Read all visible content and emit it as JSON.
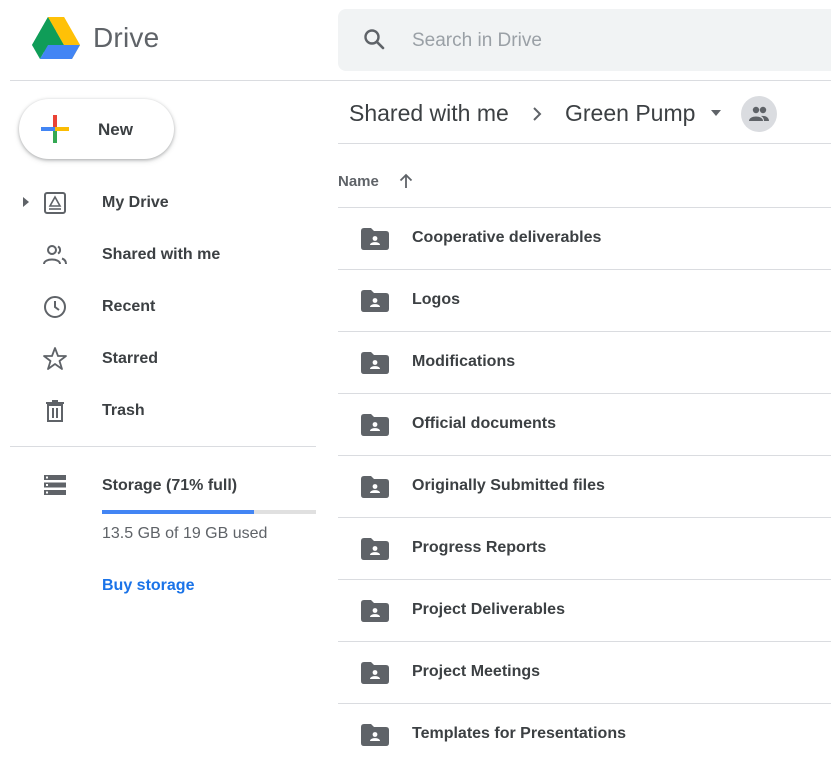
{
  "app": {
    "name": "Drive",
    "logo_icon": "google-drive-logo",
    "colors": {
      "accent": "#1a73e8",
      "storage_bar": "#4285f4",
      "folder": "#5f6368"
    }
  },
  "search": {
    "placeholder": "Search in Drive",
    "value": "",
    "icon": "search-icon"
  },
  "sidebar": {
    "new_button": {
      "label": "New",
      "icon": "plus-icon"
    },
    "items": [
      {
        "label": "My Drive",
        "icon": "my-drive-icon",
        "expandable": true
      },
      {
        "label": "Shared with me",
        "icon": "shared-people-icon"
      },
      {
        "label": "Recent",
        "icon": "clock-icon"
      },
      {
        "label": "Starred",
        "icon": "star-icon"
      },
      {
        "label": "Trash",
        "icon": "trash-icon"
      }
    ],
    "storage": {
      "label": "Storage (71% full)",
      "used_text": "13.5 GB of 19 GB used",
      "percent_used": 71,
      "buy_label": "Buy storage",
      "icon": "storage-icon"
    }
  },
  "breadcrumb": {
    "root": "Shared with me",
    "current": "Green Pump",
    "current_icon": "dropdown-arrow-icon",
    "badge_icon": "shared-people-icon"
  },
  "list": {
    "column_header": "Name",
    "sort": "ascending",
    "items": [
      {
        "name": "Cooperative deliverables",
        "icon": "shared-folder-icon"
      },
      {
        "name": "Logos",
        "icon": "shared-folder-icon"
      },
      {
        "name": "Modifications",
        "icon": "shared-folder-icon"
      },
      {
        "name": "Official documents",
        "icon": "shared-folder-icon"
      },
      {
        "name": "Originally Submitted files",
        "icon": "shared-folder-icon"
      },
      {
        "name": "Progress Reports",
        "icon": "shared-folder-icon"
      },
      {
        "name": "Project Deliverables",
        "icon": "shared-folder-icon"
      },
      {
        "name": "Project Meetings",
        "icon": "shared-folder-icon"
      },
      {
        "name": "Templates for Presentations",
        "icon": "shared-folder-icon"
      }
    ]
  }
}
